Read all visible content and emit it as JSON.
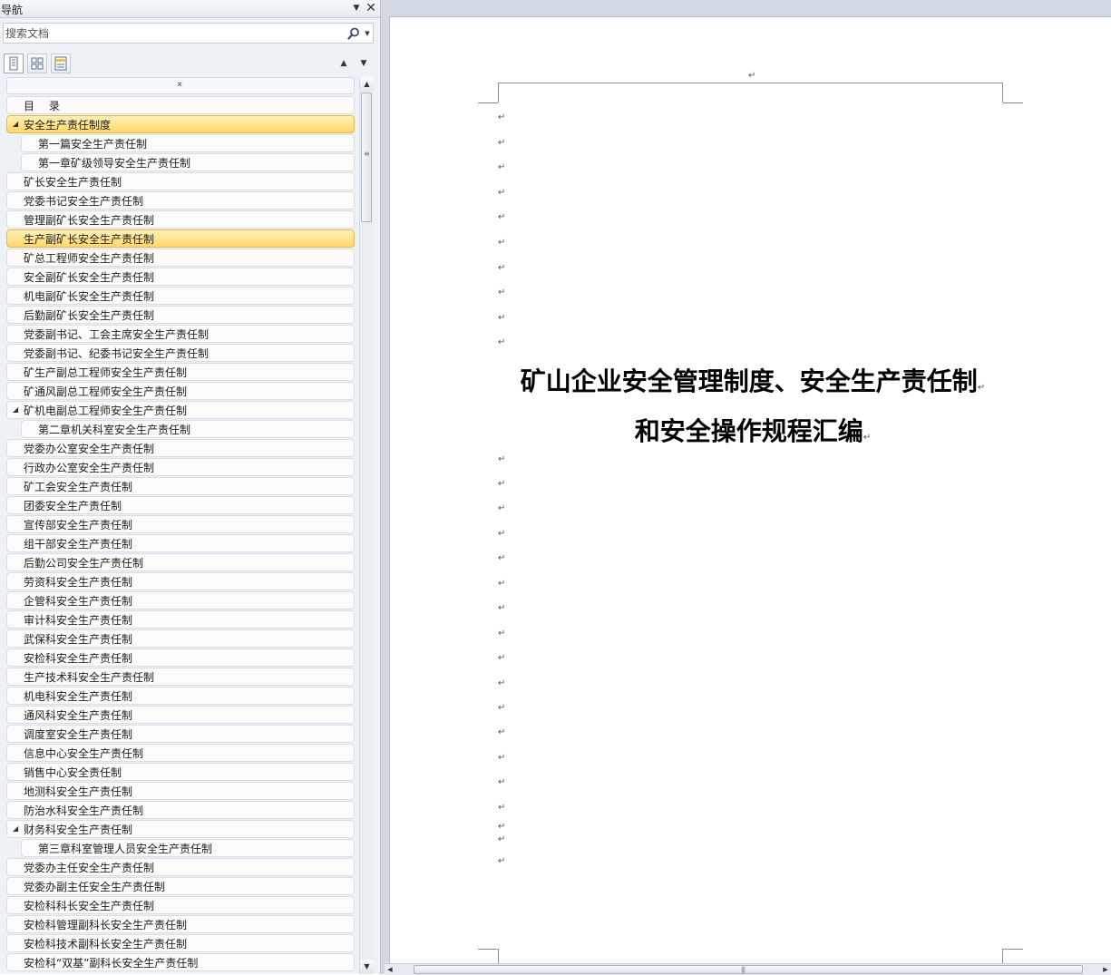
{
  "nav": {
    "title": "导航",
    "dropdown_glyph": "▼",
    "close_glyph": "✕",
    "search_placeholder": "搜索文档",
    "search_drop_glyph": "▼",
    "up_glyph": "▲",
    "down_glyph": "▼",
    "collapse_glyph": "⌅",
    "expanded_glyph": "◢",
    "scroll_up_glyph": "▲",
    "scroll_down_glyph": "▼",
    "scroll_grip_glyph": "≡",
    "selected_color": "#ffd86b",
    "headings": [
      {
        "label": "目　 录",
        "level": 1,
        "expanded": false,
        "selected": false
      },
      {
        "label": "安全生产责任制度",
        "level": 1,
        "expanded": true,
        "selected": true
      },
      {
        "label": "第一篇安全生产责任制",
        "level": 2,
        "expanded": false,
        "selected": false
      },
      {
        "label": "第一章矿级领导安全生产责任制",
        "level": 2,
        "expanded": false,
        "selected": false
      },
      {
        "label": "矿长安全生产责任制",
        "level": 1,
        "expanded": false,
        "selected": false
      },
      {
        "label": "党委书记安全生产责任制",
        "level": 1,
        "expanded": false,
        "selected": false
      },
      {
        "label": "管理副矿长安全生产责任制",
        "level": 1,
        "expanded": false,
        "selected": false
      },
      {
        "label": "生产副矿长安全生产责任制",
        "level": 1,
        "expanded": false,
        "selected": true
      },
      {
        "label": "矿总工程师安全生产责任制",
        "level": 1,
        "expanded": false,
        "selected": false
      },
      {
        "label": "安全副矿长安全生产责任制",
        "level": 1,
        "expanded": false,
        "selected": false
      },
      {
        "label": "机电副矿长安全生产责任制",
        "level": 1,
        "expanded": false,
        "selected": false
      },
      {
        "label": "后勤副矿长安全生产责任制",
        "level": 1,
        "expanded": false,
        "selected": false
      },
      {
        "label": "党委副书记、工会主席安全生产责任制",
        "level": 1,
        "expanded": false,
        "selected": false
      },
      {
        "label": "党委副书记、纪委书记安全生产责任制",
        "level": 1,
        "expanded": false,
        "selected": false
      },
      {
        "label": "矿生产副总工程师安全生产责任制",
        "level": 1,
        "expanded": false,
        "selected": false
      },
      {
        "label": "矿通风副总工程师安全生产责任制",
        "level": 1,
        "expanded": false,
        "selected": false
      },
      {
        "label": "矿机电副总工程师安全生产责任制",
        "level": 1,
        "expanded": true,
        "selected": false
      },
      {
        "label": "第二章机关科室安全生产责任制",
        "level": 2,
        "expanded": false,
        "selected": false
      },
      {
        "label": "党委办公室安全生产责任制",
        "level": 1,
        "expanded": false,
        "selected": false
      },
      {
        "label": "行政办公室安全生产责任制",
        "level": 1,
        "expanded": false,
        "selected": false
      },
      {
        "label": "矿工会安全生产责任制",
        "level": 1,
        "expanded": false,
        "selected": false
      },
      {
        "label": "团委安全生产责任制",
        "level": 1,
        "expanded": false,
        "selected": false
      },
      {
        "label": "宣传部安全生产责任制",
        "level": 1,
        "expanded": false,
        "selected": false
      },
      {
        "label": "组干部安全生产责任制",
        "level": 1,
        "expanded": false,
        "selected": false
      },
      {
        "label": "后勤公司安全生产责任制",
        "level": 1,
        "expanded": false,
        "selected": false
      },
      {
        "label": "劳资科安全生产责任制",
        "level": 1,
        "expanded": false,
        "selected": false
      },
      {
        "label": "企管科安全生产责任制",
        "level": 1,
        "expanded": false,
        "selected": false
      },
      {
        "label": "审计科安全生产责任制",
        "level": 1,
        "expanded": false,
        "selected": false
      },
      {
        "label": "武保科安全生产责任制",
        "level": 1,
        "expanded": false,
        "selected": false
      },
      {
        "label": "安检科安全生产责任制",
        "level": 1,
        "expanded": false,
        "selected": false
      },
      {
        "label": "生产技术科安全生产责任制",
        "level": 1,
        "expanded": false,
        "selected": false
      },
      {
        "label": "机电科安全生产责任制",
        "level": 1,
        "expanded": false,
        "selected": false
      },
      {
        "label": "通风科安全生产责任制",
        "level": 1,
        "expanded": false,
        "selected": false
      },
      {
        "label": "调度室安全生产责任制",
        "level": 1,
        "expanded": false,
        "selected": false
      },
      {
        "label": "信息中心安全生产责任制",
        "level": 1,
        "expanded": false,
        "selected": false
      },
      {
        "label": "销售中心安全责任制",
        "level": 1,
        "expanded": false,
        "selected": false
      },
      {
        "label": "地测科安全生产责任制",
        "level": 1,
        "expanded": false,
        "selected": false
      },
      {
        "label": "防治水科安全生产责任制",
        "level": 1,
        "expanded": false,
        "selected": false
      },
      {
        "label": "财务科安全生产责任制",
        "level": 1,
        "expanded": true,
        "selected": false
      },
      {
        "label": "第三章科室管理人员安全生产责任制",
        "level": 2,
        "expanded": false,
        "selected": false
      },
      {
        "label": "党委办主任安全生产责任制",
        "level": 1,
        "expanded": false,
        "selected": false
      },
      {
        "label": "党委办副主任安全生产责任制",
        "level": 1,
        "expanded": false,
        "selected": false
      },
      {
        "label": "安检科科长安全生产责任制",
        "level": 1,
        "expanded": false,
        "selected": false
      },
      {
        "label": "安检科管理副科长安全生产责任制",
        "level": 1,
        "expanded": false,
        "selected": false
      },
      {
        "label": "安检科技术副科长安全生产责任制",
        "level": 1,
        "expanded": false,
        "selected": false
      },
      {
        "label": "安检科“双基”副科长安全生产责任制",
        "level": 1,
        "expanded": false,
        "selected": false
      }
    ]
  },
  "document": {
    "paragraph_mark": "↵",
    "title_line1": "矿山企业安全管理制度、安全生产责任制",
    "title_line2": "和安全操作规程汇编"
  },
  "scrollbars": {
    "left_glyph": "◀",
    "right_glyph": "▶",
    "grip_glyph": "|||"
  }
}
